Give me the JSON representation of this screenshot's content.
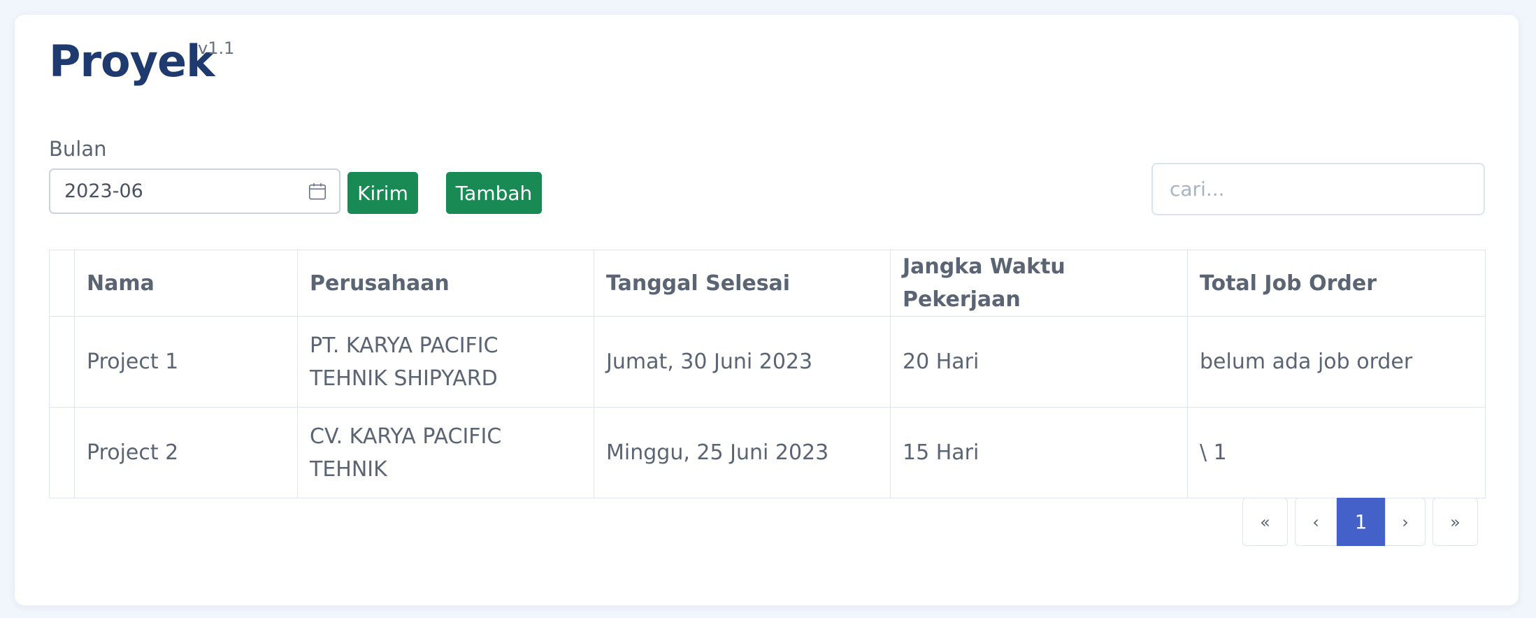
{
  "header": {
    "title": "Proyek",
    "version": "v1.1"
  },
  "filter": {
    "month_label": "Bulan",
    "month_value": "2023-06",
    "send_label": "Kirim",
    "add_label": "Tambah"
  },
  "search": {
    "placeholder": "cari..."
  },
  "table": {
    "columns": [
      "",
      "Nama",
      "Perusahaan",
      "Tanggal Selesai",
      "Jangka Waktu Pekerjaan",
      "Total Job Order"
    ],
    "rows": [
      {
        "name": "Project 1",
        "company": "PT. KARYA PACIFIC TEHNIK SHIPYARD",
        "end_date": "Jumat, 30 Juni 2023",
        "duration": "20 Hari",
        "job_orders": "belum ada job order"
      },
      {
        "name": "Project 2",
        "company": "CV. KARYA PACIFIC TEHNIK",
        "end_date": "Minggu, 25 Juni 2023",
        "duration": "15 Hari",
        "job_orders": "\\ 1"
      }
    ]
  },
  "pagination": {
    "first": "«",
    "prev": "‹",
    "current": "1",
    "next": "›",
    "last": "»"
  },
  "colors": {
    "accent_green": "#1a8a55",
    "active_page": "#4461c9",
    "title": "#1f3a6e"
  }
}
